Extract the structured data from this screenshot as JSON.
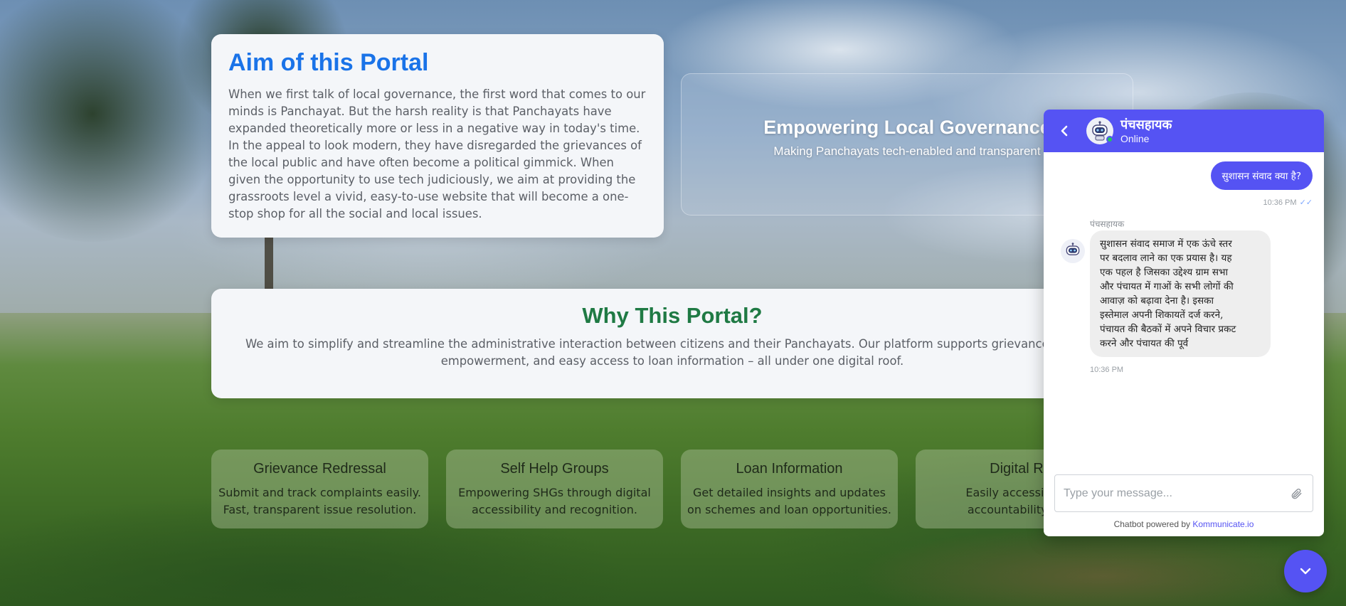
{
  "aim": {
    "title": "Aim of this Portal",
    "text": "When we first talk of local governance, the first word that comes to our minds is Panchayat. But the harsh reality is that Panchayats have expanded theoretically more or less in a negative way in today's time. In the appeal to look modern, they have disregarded the grievances of the local public and have often become a political gimmick. When given the opportunity to use tech judiciously, we aim at providing the grassroots level a vivid, easy-to-use website that will become a one-stop shop for all the social and local issues."
  },
  "hero": {
    "title": "Empowering Local Governance",
    "subtitle": "Making Panchayats tech-enabled and transparent"
  },
  "why": {
    "title": "Why This Portal?",
    "line1": "We aim to simplify and streamline the administrative interaction between citizens and their Panchayats. Our platform supports grievance submiss",
    "line2": "empowerment, and easy access to loan information – all under one digital roof."
  },
  "features": [
    {
      "title": "Grievance Redressal",
      "line1": "Submit and track complaints easily.",
      "line2": "Fast, transparent issue resolution."
    },
    {
      "title": "Self Help Groups",
      "line1": "Empowering SHGs through digital",
      "line2": "accessibility and recognition."
    },
    {
      "title": "Loan Information",
      "line1": "Get detailed insights and updates",
      "line2": "on schemes and loan opportunities."
    },
    {
      "title": "Digital Rec",
      "line1": "Easily accessible dig",
      "line2": "accountability and t"
    }
  ],
  "chat": {
    "bot_name": "पंचसहायक",
    "status": "Online",
    "user_message": "सुशासन संवाद क्या है?",
    "user_time": "10:36 PM",
    "bot_label": "पंचसहायक",
    "bot_lines": [
      "सुशासन संवाद समाज में एक ऊंचे स्तर",
      "पर बदलाव लाने का एक प्रयास है। यह",
      "एक पहल है जिसका उद्देश्य ग्राम सभा",
      "और पंचायत में गाओं के सभी लोगों की",
      "आवाज़ को बढ़ावा देना है। इसका",
      "इस्तेमाल अपनी शिकायतें दर्ज करने,",
      "पंचायत की बैठकों में अपने विचार प्रकट",
      "करने और पंचायत की पूर्व"
    ],
    "bot_time": "10:36 PM",
    "input_placeholder": "Type your message...",
    "powered_prefix": "Chatbot powered by ",
    "powered_link": "Kommunicate.io"
  },
  "icons": {
    "back": "chevron-left-icon",
    "bot": "robot-icon",
    "attach": "paperclip-icon",
    "launcher": "chevron-down-icon",
    "read": "double-check-icon"
  },
  "colors": {
    "accent": "#5553f3",
    "aim_title": "#1a73e8",
    "why_title": "#1f7a44"
  }
}
